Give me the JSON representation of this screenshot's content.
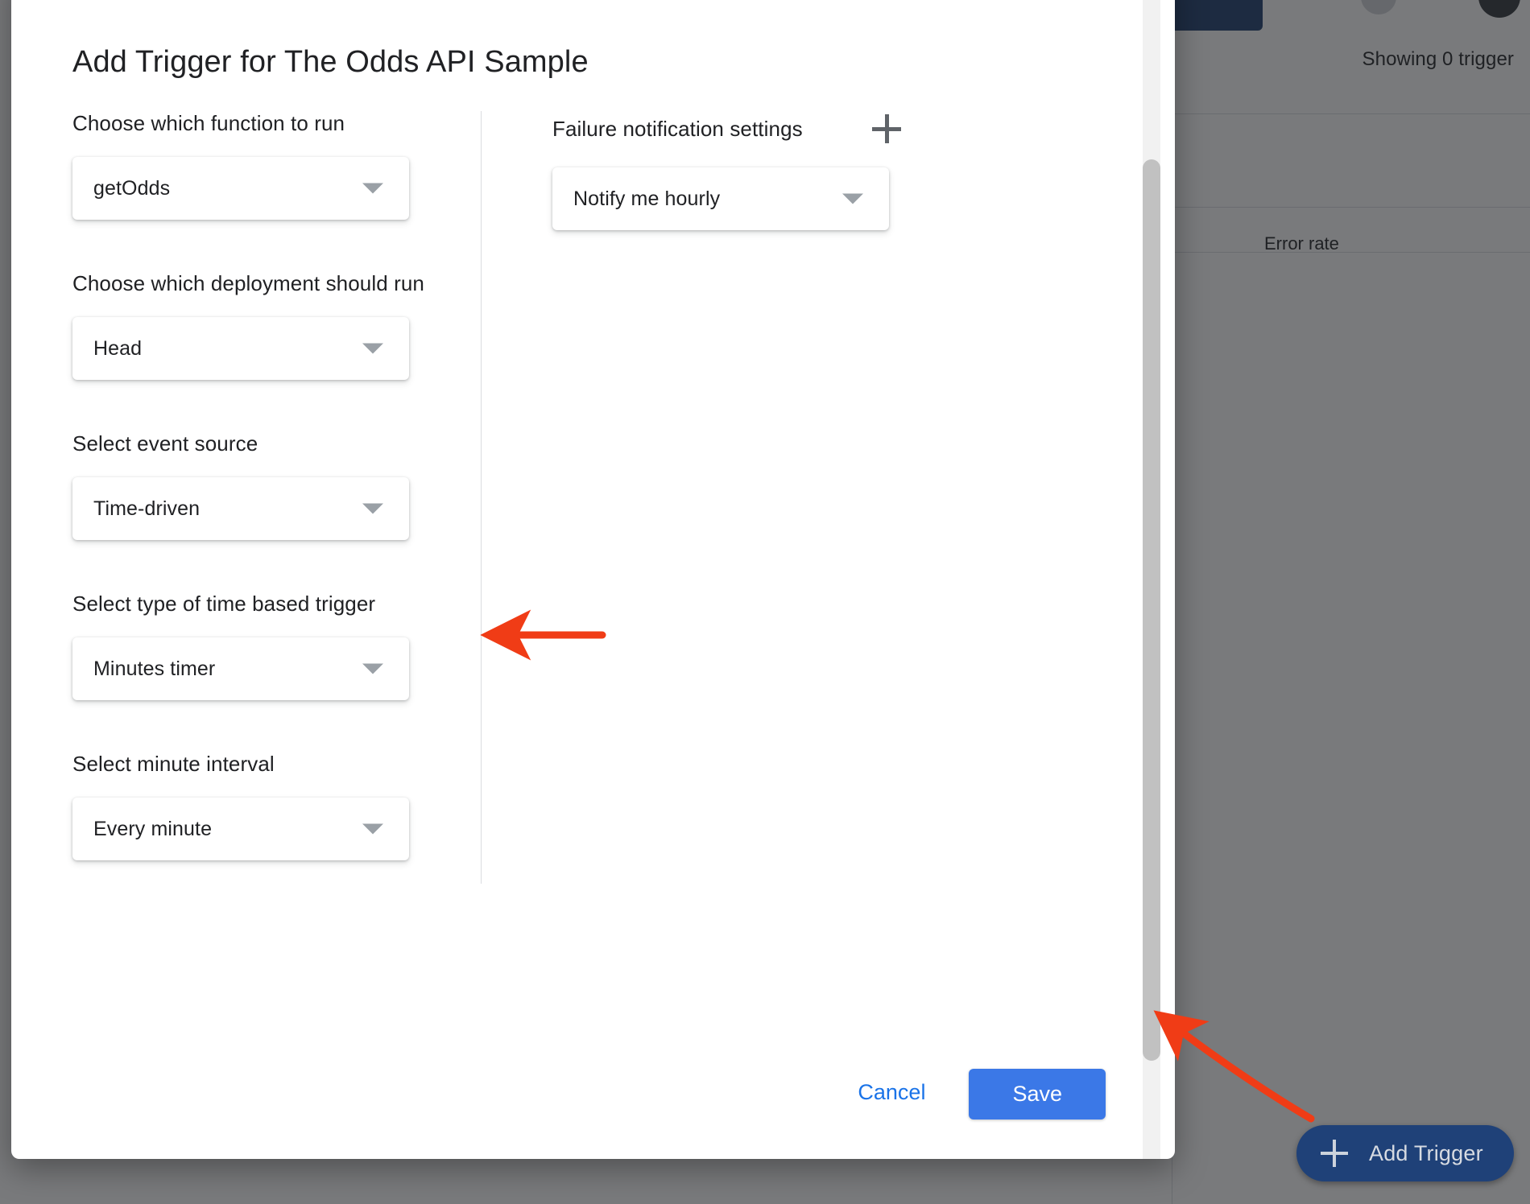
{
  "background": {
    "showing_text": "Showing 0 trigger",
    "column_header_error_rate": "Error rate"
  },
  "fab": {
    "label": "Add Trigger",
    "icon": "plus-icon",
    "color": "#1f4178"
  },
  "dialog": {
    "title": "Add Trigger for The Odds API Sample",
    "left_column": [
      {
        "label": "Choose which function to run",
        "value": "getOdds"
      },
      {
        "label": "Choose which deployment should run",
        "value": "Head"
      },
      {
        "label": "Select event source",
        "value": "Time-driven"
      },
      {
        "label": "Select type of time based trigger",
        "value": "Minutes timer"
      },
      {
        "label": "Select minute interval",
        "value": "Every minute"
      }
    ],
    "right_column": {
      "heading": "Failure notification settings",
      "add_icon": "plus-icon",
      "notify": {
        "value": "Notify me hourly"
      }
    },
    "actions": {
      "cancel_label": "Cancel",
      "save_label": "Save"
    }
  },
  "annotations": {
    "arrow_color": "#f03c16",
    "arrow_1_target": "Select event source dropdown",
    "arrow_2_target": "dialog scrollbar"
  }
}
